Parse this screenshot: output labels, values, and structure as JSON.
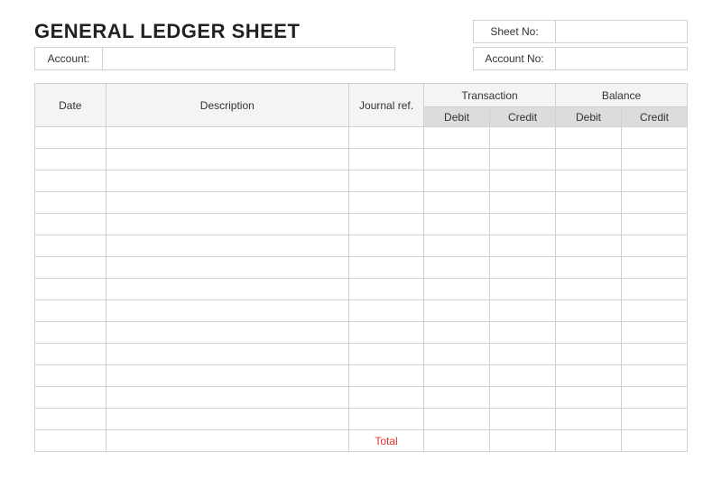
{
  "title": "GENERAL LEDGER SHEET",
  "fields": {
    "sheet_no_label": "Sheet No:",
    "sheet_no_value": "",
    "account_label": "Account:",
    "account_value": "",
    "account_no_label": "Account No:",
    "account_no_value": ""
  },
  "columns": {
    "date": "Date",
    "description": "Description",
    "journal_ref": "Journal ref.",
    "transaction": "Transaction",
    "balance": "Balance",
    "debit": "Debit",
    "credit": "Credit"
  },
  "rows": [
    {
      "date": "",
      "description": "",
      "ref": "",
      "t_debit": "",
      "t_credit": "",
      "b_debit": "",
      "b_credit": ""
    },
    {
      "date": "",
      "description": "",
      "ref": "",
      "t_debit": "",
      "t_credit": "",
      "b_debit": "",
      "b_credit": ""
    },
    {
      "date": "",
      "description": "",
      "ref": "",
      "t_debit": "",
      "t_credit": "",
      "b_debit": "",
      "b_credit": ""
    },
    {
      "date": "",
      "description": "",
      "ref": "",
      "t_debit": "",
      "t_credit": "",
      "b_debit": "",
      "b_credit": ""
    },
    {
      "date": "",
      "description": "",
      "ref": "",
      "t_debit": "",
      "t_credit": "",
      "b_debit": "",
      "b_credit": ""
    },
    {
      "date": "",
      "description": "",
      "ref": "",
      "t_debit": "",
      "t_credit": "",
      "b_debit": "",
      "b_credit": ""
    },
    {
      "date": "",
      "description": "",
      "ref": "",
      "t_debit": "",
      "t_credit": "",
      "b_debit": "",
      "b_credit": ""
    },
    {
      "date": "",
      "description": "",
      "ref": "",
      "t_debit": "",
      "t_credit": "",
      "b_debit": "",
      "b_credit": ""
    },
    {
      "date": "",
      "description": "",
      "ref": "",
      "t_debit": "",
      "t_credit": "",
      "b_debit": "",
      "b_credit": ""
    },
    {
      "date": "",
      "description": "",
      "ref": "",
      "t_debit": "",
      "t_credit": "",
      "b_debit": "",
      "b_credit": ""
    },
    {
      "date": "",
      "description": "",
      "ref": "",
      "t_debit": "",
      "t_credit": "",
      "b_debit": "",
      "b_credit": ""
    },
    {
      "date": "",
      "description": "",
      "ref": "",
      "t_debit": "",
      "t_credit": "",
      "b_debit": "",
      "b_credit": ""
    },
    {
      "date": "",
      "description": "",
      "ref": "",
      "t_debit": "",
      "t_credit": "",
      "b_debit": "",
      "b_credit": ""
    },
    {
      "date": "",
      "description": "",
      "ref": "",
      "t_debit": "",
      "t_credit": "",
      "b_debit": "",
      "b_credit": ""
    }
  ],
  "total_label": "Total"
}
